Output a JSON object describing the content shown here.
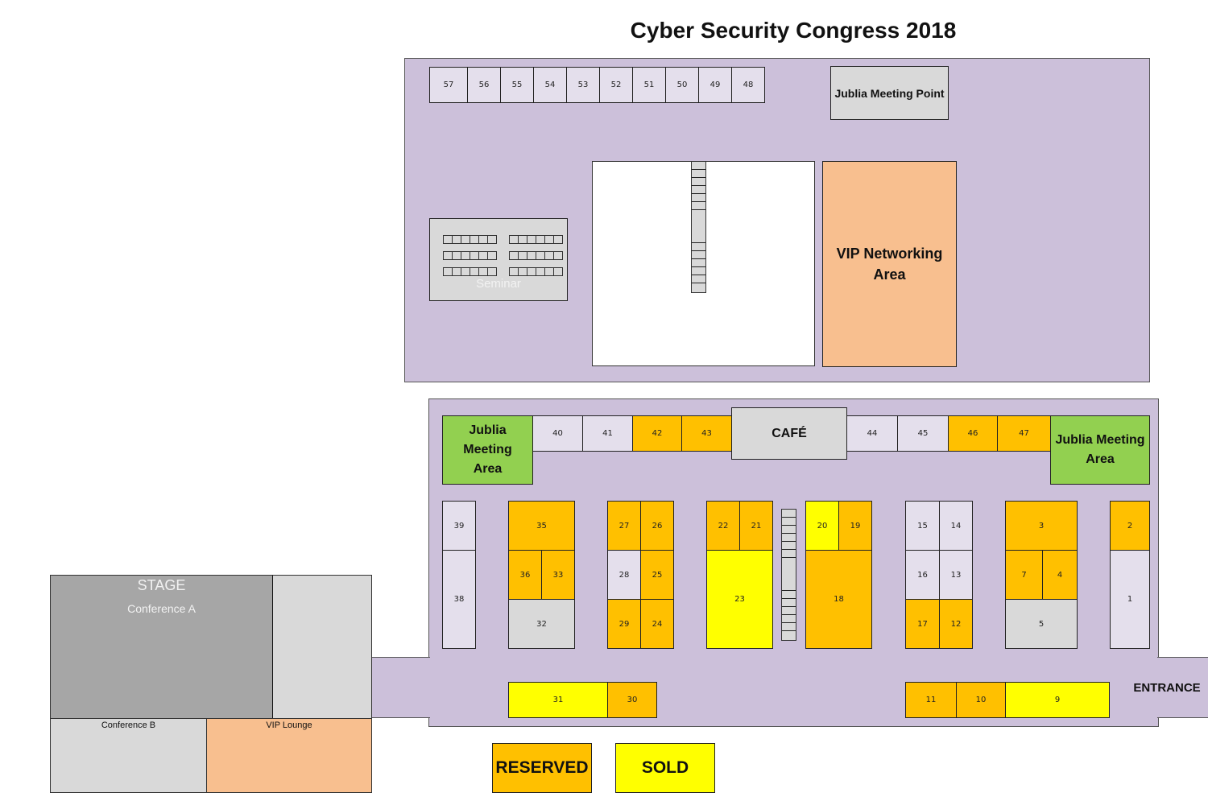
{
  "title": "Cyber Security Congress 2018",
  "colors": {
    "hall": "#ccc0da",
    "available": "#e4dfec",
    "reserved": "#ffc000",
    "sold": "#ffff00",
    "meeting_area": "#92d050",
    "vip": "#f8bf8f",
    "stage": "#a6a6a6",
    "neutral": "#d9d9d9"
  },
  "upper_hall": {
    "booths_row": [
      "57",
      "56",
      "55",
      "54",
      "53",
      "52",
      "51",
      "50",
      "49",
      "48"
    ],
    "meeting_point": "Jublia Meeting Point",
    "seminar": "Seminar",
    "vip_networking": "VIP Networking Area"
  },
  "lower_hall": {
    "left_meeting": "Jublia Meeting Area",
    "right_meeting": "Jublia Meeting Area",
    "cafe": "CAFÉ",
    "entrance": "ENTRANCE",
    "booths": {
      "b40": "40",
      "b41": "41",
      "b42": "42",
      "b43": "43",
      "b44": "44",
      "b45": "45",
      "b46": "46",
      "b47": "47",
      "b39": "39",
      "b38": "38",
      "b35": "35",
      "b36": "36",
      "b33": "33",
      "b32": "32",
      "b27": "27",
      "b26": "26",
      "b28": "28",
      "b25": "25",
      "b29": "29",
      "b24": "24",
      "b22": "22",
      "b21": "21",
      "b23": "23",
      "b20": "20",
      "b19": "19",
      "b18": "18",
      "b15": "15",
      "b14": "14",
      "b16": "16",
      "b13": "13",
      "b17": "17",
      "b12": "12",
      "b3": "3",
      "b7": "7",
      "b4": "4",
      "b5": "5",
      "b2": "2",
      "b1": "1",
      "b31": "31",
      "b30": "30",
      "b11": "11",
      "b10": "10",
      "b9": "9"
    },
    "booth_status": {
      "reserved": [
        "42",
        "43",
        "46",
        "47",
        "35",
        "36",
        "33",
        "27",
        "26",
        "25",
        "29",
        "24",
        "22",
        "21",
        "19",
        "18",
        "17",
        "12",
        "3",
        "7",
        "4",
        "2",
        "30",
        "11",
        "10"
      ],
      "sold": [
        "23",
        "20",
        "31",
        "9"
      ],
      "available": [
        "40",
        "41",
        "44",
        "45",
        "39",
        "38",
        "28",
        "15",
        "14",
        "16",
        "13",
        "1"
      ],
      "unassigned": [
        "32",
        "5"
      ]
    }
  },
  "conference": {
    "stage": "STAGE",
    "conference_a": "Conference A",
    "conference_b": "Conference B",
    "vip_lounge": "VIP Lounge"
  },
  "legend": {
    "reserved": "RESERVED",
    "sold": "SOLD"
  }
}
